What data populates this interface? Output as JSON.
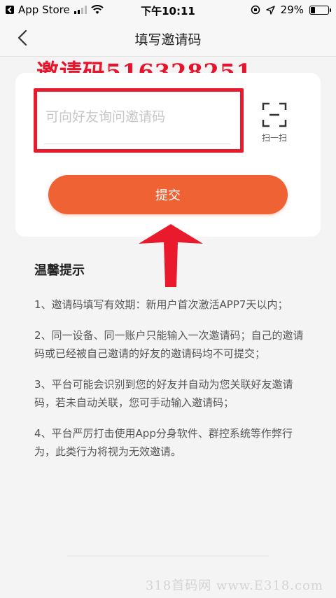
{
  "status_bar": {
    "back_app": "App Store",
    "time": "下午10:11",
    "battery": "29%",
    "battery_level": 0.29
  },
  "nav": {
    "title": "填写邀请码"
  },
  "overlay": {
    "invite_code": "邀请码516328251"
  },
  "form": {
    "input_placeholder": "可向好友询问邀请码",
    "input_value": "",
    "scan_label": "扫一扫",
    "submit_label": "提交"
  },
  "tips": {
    "title": "温馨提示",
    "items": [
      "1、邀请码填写有效期：新用户首次激活APP7天以内；",
      "2、同一设备、同一账户只能输入一次邀请码；自己的邀请码或已经被自己邀请的好友的邀请码均不可提交；",
      "3、平台可能会识别到您的好友并自动为您关联好友邀请码，若未自动关联，您可手动输入邀请码；",
      "4、平台严厉打击使用App分身软件、群控系统等作弊行为，此类行为将视为无效邀请。"
    ]
  },
  "watermark": "318首码网 www.E318.com",
  "colors": {
    "accent": "#ef6234",
    "highlight_red": "#e81a2c"
  }
}
